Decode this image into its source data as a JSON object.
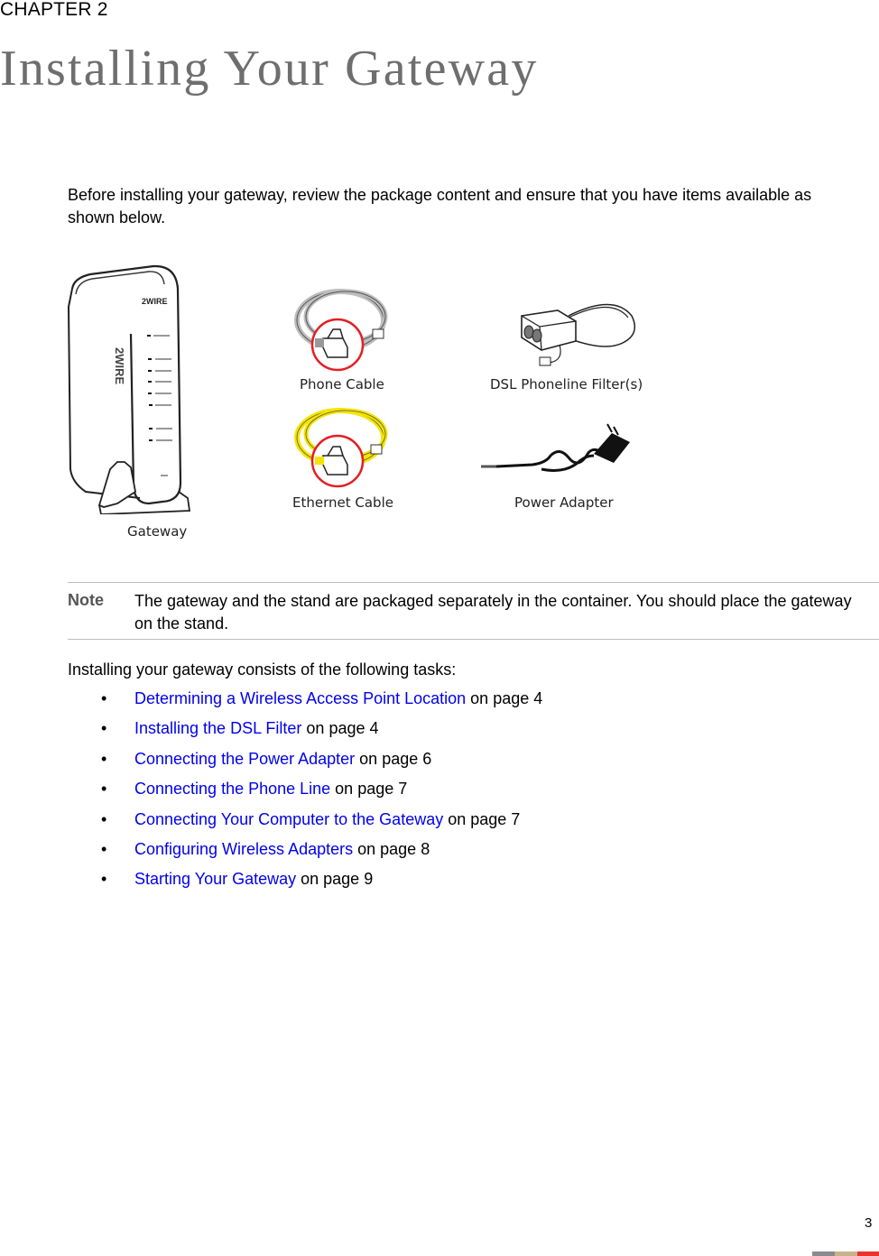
{
  "header": {
    "chapter": "CHAPTER 2",
    "title": "Installing Your Gateway"
  },
  "intro": "Before installing your gateway, review the package content and ensure that you have items available as shown below.",
  "figure": {
    "items": [
      {
        "label": "Gateway",
        "icon": "gateway-icon"
      },
      {
        "label": "Phone Cable",
        "icon": "phone-cable-icon"
      },
      {
        "label": "DSL Phoneline Filter(s)",
        "icon": "dsl-filter-icon"
      },
      {
        "label": "Ethernet Cable",
        "icon": "ethernet-cable-icon"
      },
      {
        "label": "Power Adapter",
        "icon": "power-adapter-icon"
      }
    ],
    "brand": "2WIRE",
    "colors": {
      "highlight_circle": "#e31e24",
      "ethernet_cable": "#f5e400",
      "phone_cable": "#d0d0d0"
    }
  },
  "note": {
    "label": "Note",
    "text": "The gateway and the stand are packaged separately in the container. You should place the gateway on the stand."
  },
  "tasks": {
    "intro": "Installing your gateway consists of the following tasks:",
    "bullet": "•",
    "items": [
      {
        "link": "Determining a Wireless Access Point Location",
        "suffix": " on page 4"
      },
      {
        "link": "Installing the DSL Filter",
        "suffix": " on page 4"
      },
      {
        "link": "Connecting the Power Adapter",
        "suffix": " on page 6"
      },
      {
        "link": "Connecting the Phone Line",
        "suffix": " on page 7"
      },
      {
        "link": "Connecting Your Computer to the Gateway",
        "suffix": " on page 7"
      },
      {
        "link": "Configuring Wireless Adapters",
        "suffix": " on page 8"
      },
      {
        "link": "Starting Your Gateway",
        "suffix": " on page 9"
      }
    ],
    "link_color": "#0000ee"
  },
  "footer": {
    "page_number": "3",
    "bar_colors": [
      "#8a8a8f",
      "#c8b48c",
      "#e8342c"
    ]
  }
}
